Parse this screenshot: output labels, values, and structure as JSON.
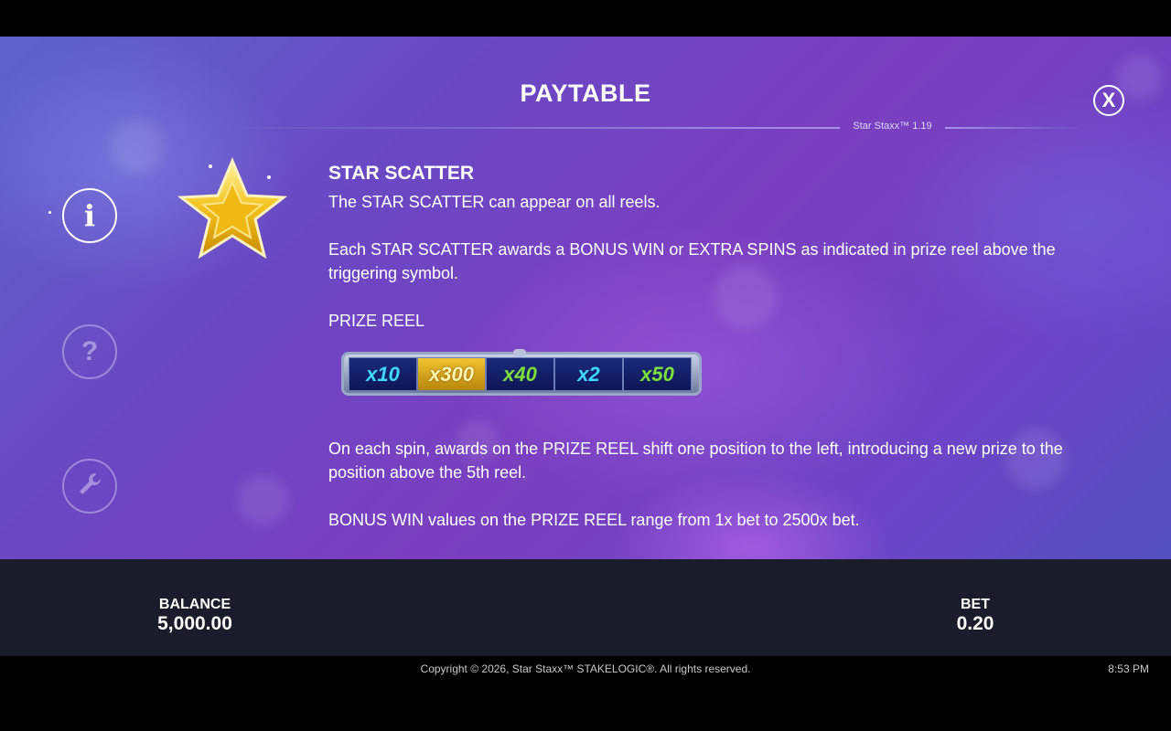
{
  "header": {
    "title": "PAYTABLE",
    "version": "Star Staxx™ 1.19",
    "close_label": "X"
  },
  "sidebar": {
    "items": [
      {
        "name": "info",
        "glyph": "i",
        "active": true
      },
      {
        "name": "help",
        "glyph": "?",
        "active": false
      },
      {
        "name": "settings",
        "icon": "wrench-icon",
        "active": false
      }
    ]
  },
  "section": {
    "symbol_icon": "star-scatter-icon",
    "heading": "STAR SCATTER",
    "para1": "The STAR SCATTER can appear on all reels.",
    "para2": "Each STAR SCATTER awards a BONUS WIN or EXTRA SPINS as indicated in prize reel above the triggering symbol.",
    "prize_reel_label": "PRIZE REEL",
    "prize_reel": [
      {
        "text": "x10",
        "color": "#3fd8ff",
        "highlight": false
      },
      {
        "text": "x300",
        "color": "#fff4b0",
        "highlight": true
      },
      {
        "text": "x40",
        "color": "#7be03a",
        "highlight": false
      },
      {
        "text": "x2",
        "color": "#3fd8ff",
        "highlight": false
      },
      {
        "text": "x50",
        "color": "#7be03a",
        "highlight": false
      }
    ],
    "para3": "On each spin, awards on the PRIZE REEL shift one position to the left, introducing a new prize to the position above the 5th reel.",
    "para4": "BONUS WIN values on the PRIZE REEL range from 1x bet to 2500x bet."
  },
  "status_bar": {
    "balance_label": "BALANCE",
    "balance_value": "5,000.00",
    "bet_label": "BET",
    "bet_value": "0.20"
  },
  "footer": {
    "copyright": "Copyright © 2026, Star Staxx™ STAKELOGIC®. All rights reserved.",
    "time": "8:53 PM"
  },
  "colors": {
    "accent_gold": "#f0c531",
    "bottom_bar": "#1b1c2b"
  }
}
